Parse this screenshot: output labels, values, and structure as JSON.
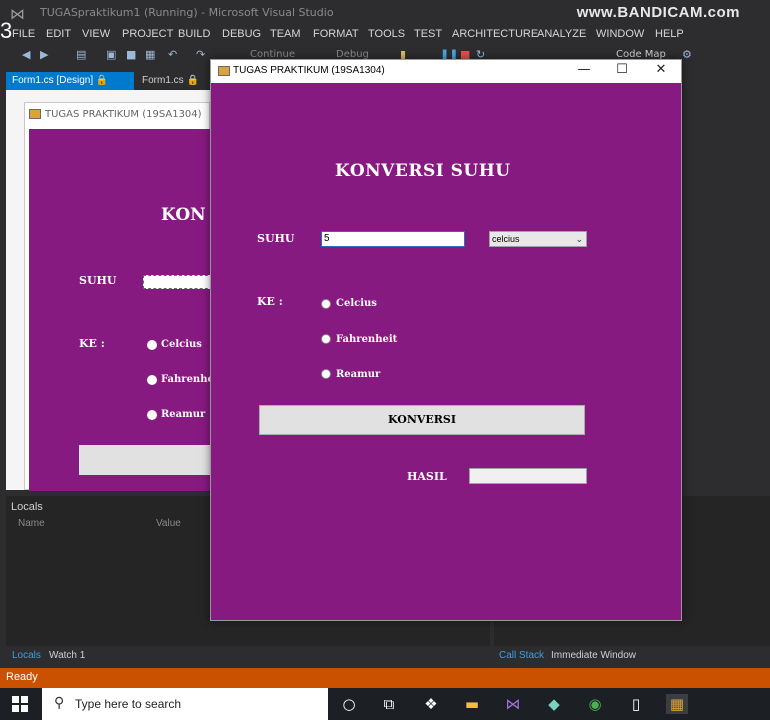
{
  "vs": {
    "title": "TUGASpraktikum1 (Running) - Microsoft Visual Studio",
    "watermark": "www.BANDICAM.com",
    "step": "3",
    "menu": [
      "FILE",
      "EDIT",
      "VIEW",
      "PROJECT",
      "BUILD",
      "DEBUG",
      "TEAM",
      "FORMAT",
      "TOOLS",
      "TEST",
      "ARCHITECTURE",
      "ANALYZE",
      "WINDOW",
      "HELP"
    ],
    "toolbar": {
      "continue": "Continue",
      "config": "Debug",
      "codemap": "Code Map"
    },
    "tabs": {
      "design": "Form1.cs [Design]",
      "code": "Form1.cs"
    },
    "designer": {
      "form_title": "TUGAS PRAKTIKUM (19SA1304)",
      "heading_partial": "KON",
      "suhu": "SUHU",
      "ke": "KE :",
      "radio1": "Celcius",
      "radio2": "Fahrenhe",
      "radio3": "Reamur"
    },
    "locals": {
      "title": "Locals",
      "col_name": "Name",
      "col_value": "Value"
    },
    "bottom_tabs": {
      "locals": "Locals",
      "watch": "Watch 1",
      "callstack": "Call Stack",
      "immediate": "Immediate Window"
    },
    "status": "Ready"
  },
  "app": {
    "title": "TUGAS PRAKTIKUM (19SA1304)",
    "heading": "KONVERSI SUHU",
    "suhu_label": "SUHU",
    "suhu_value": "5",
    "unit_selected": "celcius",
    "ke_label": "KE :",
    "options": [
      "Celcius",
      "Fahrenheit",
      "Reamur"
    ],
    "button": "KONVERSI",
    "hasil_label": "HASIL",
    "hasil_value": ""
  },
  "taskbar": {
    "search_placeholder": "Type here to search"
  },
  "colors": {
    "form_bg": "#861a80",
    "vs_bg": "#2d2d30",
    "status_bar": "#ca5100",
    "accent": "#007acc"
  }
}
